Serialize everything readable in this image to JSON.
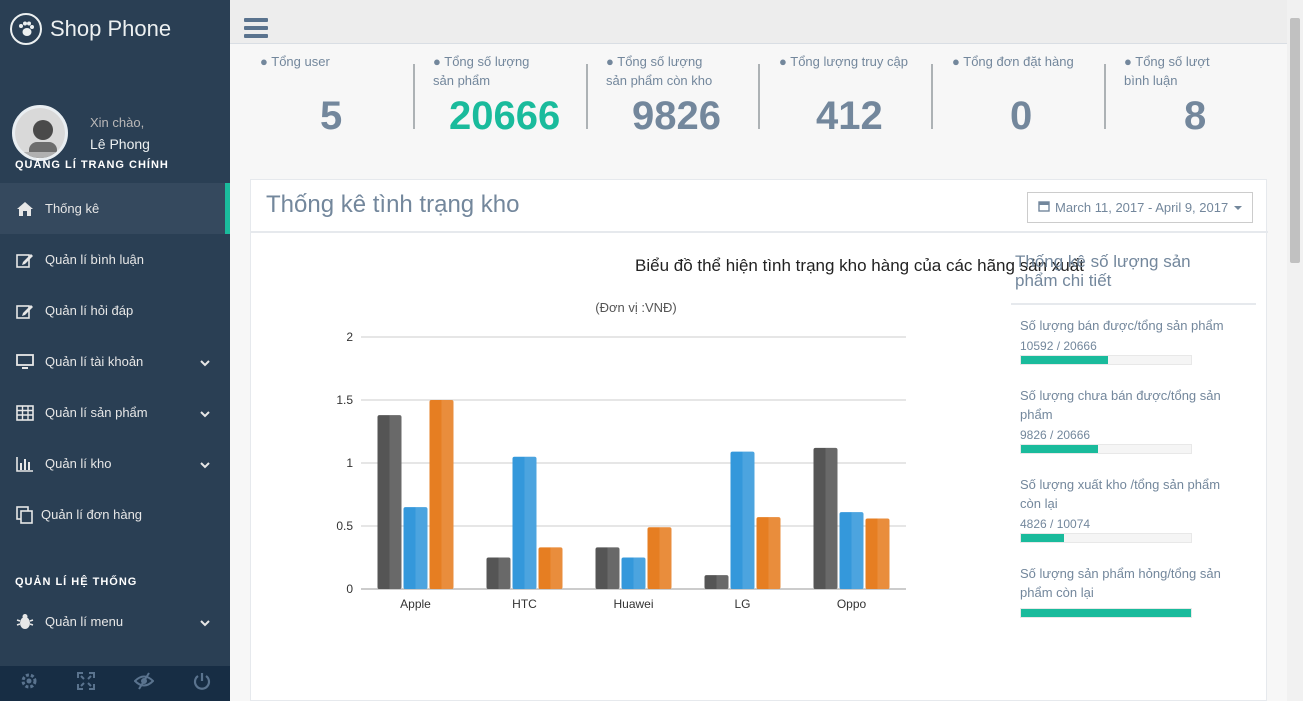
{
  "app": {
    "title": "Shop Phone"
  },
  "profile": {
    "greeting": "Xin chào,",
    "name": "Lê Phong"
  },
  "sidebar": {
    "section_main": "QUẢNG LÍ TRANG CHÍNH",
    "section_system": "QUẢN LÍ HỆ THỐNG",
    "items": [
      {
        "label": "Thống kê",
        "icon": "home-icon",
        "active": true
      },
      {
        "label": "Quản lí bình luận",
        "icon": "edit-icon"
      },
      {
        "label": "Quản lí hỏi đáp",
        "icon": "edit-icon"
      },
      {
        "label": "Quản lí tài khoản",
        "icon": "desktop-icon",
        "chevron": true
      },
      {
        "label": "Quản lí sản phẩm",
        "icon": "table-icon",
        "chevron": true
      },
      {
        "label": "Quản lí kho",
        "icon": "bar-chart-icon",
        "chevron": true
      },
      {
        "label": "Quản lí đơn hàng",
        "icon": "copy-icon"
      }
    ],
    "system_items": [
      {
        "label": "Quản lí menu",
        "icon": "bug-icon",
        "chevron": true
      }
    ]
  },
  "stats": [
    {
      "label_1": "Tổng user",
      "label_2": "",
      "value": "5"
    },
    {
      "label_1": "Tổng số lượng",
      "label_2": "sản phẩm",
      "value": "20666",
      "accent": "#1abb9c"
    },
    {
      "label_1": "Tổng số lượng",
      "label_2": "sản phẩm còn kho",
      "value": "9826"
    },
    {
      "label_1": "Tổng lượng truy cập",
      "label_2": "",
      "value": "412"
    },
    {
      "label_1": "Tổng đơn đặt hàng",
      "label_2": "",
      "value": "0"
    },
    {
      "label_1": "Tổng số lượt",
      "label_2": "bình luận",
      "value": "8"
    }
  ],
  "panel": {
    "title": "Thống kê tình trạng kho",
    "date_range": "March 11, 2017 - April 9, 2017"
  },
  "chart_data": {
    "type": "bar",
    "title": "Biểu đồ thể hiện tình trạng kho hàng của các hãng sản xuất",
    "subtitle": "(Đơn vị :VNĐ)",
    "categories": [
      "Apple",
      "HTC",
      "Huawei",
      "LG",
      "Oppo"
    ],
    "ylim": [
      0,
      2
    ],
    "yticks": [
      "0",
      "0.5",
      "1",
      "1.5",
      "2"
    ],
    "grid": true,
    "series": [
      {
        "values": [
          1.38,
          0.25,
          0.33,
          0.11,
          1.12
        ],
        "color": "#555555"
      },
      {
        "values": [
          0.65,
          1.05,
          0.25,
          1.09,
          0.61
        ],
        "color": "#3498db"
      },
      {
        "values": [
          1.5,
          0.33,
          0.49,
          0.57,
          0.56
        ],
        "color": "#e67e22"
      }
    ]
  },
  "side_stats": {
    "title": "Thống kê số lượng sản phẩm chi tiết",
    "items": [
      {
        "label": "Số lượng bán được/tổng sản phẩm",
        "value": "10592 / 20666",
        "fraction": 0.51
      },
      {
        "label": "Số lượng chưa bán được/tổng sản phẩm",
        "value": "9826 / 20666",
        "fraction": 0.45
      },
      {
        "label": "Số lượng xuất kho /tổng sản phẩm còn lại",
        "value": "4826 / 10074",
        "fraction": 0.25
      },
      {
        "label": "Số lượng sản phẩm hỏng/tổng sản phẩm còn lại",
        "value": "",
        "fraction": 1.0
      }
    ]
  },
  "colors": {
    "accent": "#1abb9c",
    "sidebar": "#2a3f54"
  }
}
